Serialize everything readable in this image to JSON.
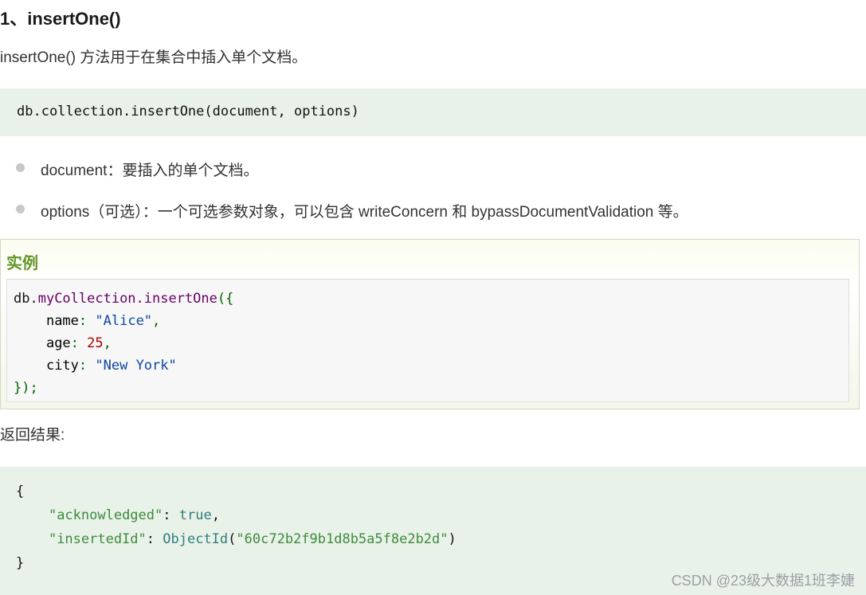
{
  "heading": "1、insertOne()",
  "intro": "insertOne() 方法用于在集合中插入单个文档。",
  "syntax": "db.collection.insertOne(document, options)",
  "params": [
    {
      "text": "document：要插入的单个文档。"
    },
    {
      "text": "options（可选）：一个可选参数对象，可以包含 writeConcern 和 bypassDocumentValidation 等。"
    }
  ],
  "example": {
    "title": "实例",
    "line1": {
      "obj": "db.",
      "meth": "myCollection.insertOne",
      "punc": "({"
    },
    "line2": {
      "indent": "    ",
      "key": "name",
      "sep": ": ",
      "val": "\"Alice\"",
      "end": ","
    },
    "line3": {
      "indent": "    ",
      "key": "age",
      "sep": ": ",
      "val": "25",
      "end": ","
    },
    "line4": {
      "indent": "    ",
      "key": "city",
      "sep": ": ",
      "val": "\"New York\""
    },
    "line5": "});"
  },
  "result_label": "返回结果:",
  "result": {
    "open": "{",
    "line1": {
      "indent": "    ",
      "key": "\"acknowledged\"",
      "sep": ": ",
      "val": "true",
      "end": ","
    },
    "line2": {
      "indent": "    ",
      "key": "\"insertedId\"",
      "sep": ": ",
      "fn": "ObjectId",
      "paren_open": "(",
      "val": "\"60c72b2f9b1d8b5a5f8e2b2d\"",
      "paren_close": ")"
    },
    "close": "}"
  },
  "watermark": "CSDN @23级大数据1班李婕"
}
